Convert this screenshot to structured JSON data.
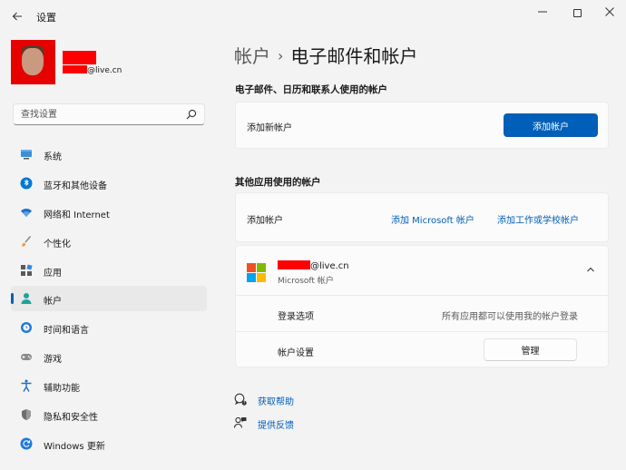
{
  "window": {
    "title": "设置",
    "back_icon": "arrow-left-icon",
    "minimize_icon": "minimize-icon",
    "maximize_icon": "maximize-icon",
    "close_icon": "close-icon"
  },
  "user": {
    "email_suffix": "@live.cn"
  },
  "search": {
    "placeholder": "查找设置",
    "icon": "search-icon"
  },
  "sidebar": {
    "items": [
      {
        "label": "系统",
        "icon": "monitor-icon",
        "active": false
      },
      {
        "label": "蓝牙和其他设备",
        "icon": "bluetooth-icon",
        "active": false
      },
      {
        "label": "网络和 Internet",
        "icon": "wifi-icon",
        "active": false
      },
      {
        "label": "个性化",
        "icon": "brush-icon",
        "active": false
      },
      {
        "label": "应用",
        "icon": "apps-icon",
        "active": false
      },
      {
        "label": "帐户",
        "icon": "person-icon",
        "active": true
      },
      {
        "label": "时间和语言",
        "icon": "globe-clock-icon",
        "active": false
      },
      {
        "label": "游戏",
        "icon": "gamepad-icon",
        "active": false
      },
      {
        "label": "辅助功能",
        "icon": "accessibility-icon",
        "active": false
      },
      {
        "label": "隐私和安全性",
        "icon": "shield-icon",
        "active": false
      },
      {
        "label": "Windows 更新",
        "icon": "update-icon",
        "active": false
      }
    ]
  },
  "main": {
    "breadcrumb": {
      "parent": "帐户",
      "separator": "›",
      "current": "电子邮件和帐户"
    },
    "email_section": {
      "title": "电子邮件、日历和联系人使用的帐户",
      "row_label": "添加新帐户",
      "button_label": "添加帐户"
    },
    "apps_section": {
      "title": "其他应用使用的帐户",
      "row_label": "添加帐户",
      "link_microsoft": "添加 Microsoft 帐户",
      "link_work": "添加工作或学校帐户"
    },
    "account": {
      "email_suffix": "@live.cn",
      "type": "Microsoft 帐户",
      "logo_colors": [
        "#f25022",
        "#7fba00",
        "#00a4ef",
        "#ffb900"
      ],
      "signin_label": "登录选项",
      "signin_value": "所有应用都可以使用我的帐户登录",
      "settings_label": "帐户设置",
      "manage_label": "管理"
    },
    "help": {
      "get_help": "获取帮助",
      "feedback": "提供反馈"
    }
  },
  "colors": {
    "accent": "#005fb8",
    "background": "#f3f3f3",
    "card": "#fbfbfb",
    "redaction": "#ff0000"
  }
}
